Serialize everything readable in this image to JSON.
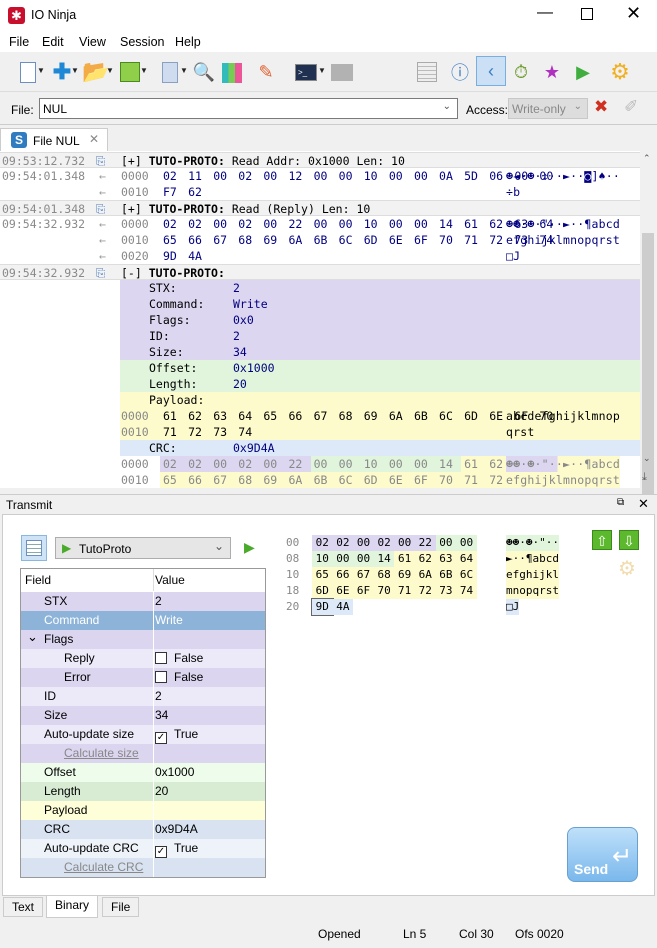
{
  "window": {
    "title": "IO Ninja",
    "minimize_icon": "minimize-icon",
    "maximize_icon": "maximize-icon",
    "close_icon": "close-icon"
  },
  "menu": [
    "File",
    "Edit",
    "View",
    "Session",
    "Help"
  ],
  "toolbar": {
    "icons": [
      "new-session-icon",
      "add-icon",
      "open-icon",
      "save-icon",
      "hex-view-icon",
      "find-icon",
      "highlighter-icon",
      "clear-log-icon",
      "terminal-icon",
      "terminal-disabled-icon",
      "log-filter-icon",
      "info-icon",
      "packet-icon",
      "timer-icon",
      "star-icon",
      "play-script-icon",
      "settings-icon"
    ]
  },
  "filebar": {
    "file_label": "File:",
    "file_value": "NUL",
    "access_label": "Access:",
    "access_value": "Write-only"
  },
  "session_tab": {
    "label": "File NUL"
  },
  "colors": {
    "purple": "#dcd6f0",
    "green": "#e0f5dc",
    "yellow": "#fdfbcc",
    "blue": "#dde8f8",
    "header": "#f2f2f2",
    "selected": "#8db4d8",
    "accent": "#5aa02c"
  },
  "log": [
    {
      "kind": "header",
      "time": "09:53:12.732",
      "expand": "[+]",
      "proto": "TUTO-PROTO:",
      "text": " Read Addr: 0x1000 Len: 10"
    },
    {
      "kind": "hex",
      "time": "09:54:01.348",
      "arrow": "←",
      "off": "0000",
      "hex": "02 11 00 02 00 12 00 00 10 00 00 0A 5D 06 00 00",
      "ascii": "☻◄·☻·↕··►··◙]♠··"
    },
    {
      "kind": "hex",
      "arrow": "←",
      "off": "0010",
      "hex": "F7 62",
      "ascii": "÷b"
    },
    {
      "kind": "header",
      "time": "09:54:01.348",
      "expand": "[+]",
      "proto": "TUTO-PROTO:",
      "text": " Read (Reply) Len: 10"
    },
    {
      "kind": "hex",
      "time": "09:54:32.932",
      "arrow": "←",
      "off": "0000",
      "hex": "02 02 00 02 00 22 00 00 10 00 00 14 61 62 63 64",
      "ascii": "☻☻·☻·\"··►··¶abcd"
    },
    {
      "kind": "hex",
      "arrow": "←",
      "off": "0010",
      "hex": "65 66 67 68 69 6A 6B 6C 6D 6E 6F 70 71 72 73 74",
      "ascii": "efghijklmnopqrst"
    },
    {
      "kind": "hex",
      "arrow": "←",
      "off": "0020",
      "hex": "9D 4A",
      "ascii": "□J"
    },
    {
      "kind": "header",
      "time": "09:54:32.932",
      "expand": "[-]",
      "proto": "TUTO-PROTO:",
      "text": ""
    },
    {
      "kind": "field",
      "bg": "purple",
      "label": "STX:",
      "value": "2"
    },
    {
      "kind": "field",
      "bg": "purple",
      "label": "Command:",
      "value": "Write"
    },
    {
      "kind": "field",
      "bg": "purple",
      "label": "Flags:",
      "value": "0x0"
    },
    {
      "kind": "field",
      "bg": "purple",
      "label": "ID:",
      "value": "2"
    },
    {
      "kind": "field",
      "bg": "purple",
      "label": "Size:",
      "value": "34"
    },
    {
      "kind": "field",
      "bg": "green",
      "label": "Offset:",
      "value": "0x1000"
    },
    {
      "kind": "field",
      "bg": "green",
      "label": "Length:",
      "value": "20"
    },
    {
      "kind": "field",
      "bg": "yellow",
      "label": "Payload:",
      "value": ""
    },
    {
      "kind": "hex",
      "bg": "yellow",
      "dark": true,
      "off": "0000",
      "hex": "61 62 63 64 65 66 67 68 69 6A 6B 6C 6D 6E 6F 70",
      "ascii": "abcdefghijklmnop"
    },
    {
      "kind": "hex",
      "bg": "yellow",
      "dark": true,
      "off": "0010",
      "hex": "71 72 73 74",
      "ascii": "qrst"
    },
    {
      "kind": "field",
      "bg": "blue",
      "label": "CRC:",
      "value": "0x9D4A"
    },
    {
      "kind": "hex",
      "seg": [
        "purple",
        "purple",
        "purple",
        "purple",
        "purple",
        "purple",
        "green",
        "green",
        "green",
        "green",
        "green",
        "green",
        "yellow",
        "yellow",
        "yellow",
        "yellow"
      ],
      "off": "0000",
      "hex": "02 02 00 02 00 22 00 00 10 00 00 14 61 62 63 64",
      "ascii": "☻☻·☻·\"··►··¶abcd"
    },
    {
      "kind": "hex",
      "seg": [
        "yellow",
        "yellow",
        "yellow",
        "yellow",
        "yellow",
        "yellow",
        "yellow",
        "yellow",
        "yellow",
        "yellow",
        "yellow",
        "yellow",
        "yellow",
        "yellow",
        "yellow",
        "yellow"
      ],
      "off": "0010",
      "hex": "65 66 67 68 69 6A 6B 6C 6D 6E 6F 70 71 72 73 74",
      "ascii": "efghijklmnopqrst"
    }
  ],
  "transmit": {
    "title": "Transmit",
    "protocol": "TutoProto",
    "grid_headers": {
      "field": "Field",
      "value": "Value"
    },
    "grid": [
      {
        "field": "STX",
        "value": "2",
        "bg": "#dcd5ef",
        "indent": 0
      },
      {
        "field": "Command",
        "value": "Write",
        "bg": "#8db4d8",
        "indent": 0,
        "selected": true
      },
      {
        "field": "Flags",
        "value": "",
        "bg": "#dcd5ef",
        "indent": 0,
        "expander": "⌄"
      },
      {
        "field": "Reply",
        "value": "False",
        "bg": "#ece9f8",
        "indent": 1,
        "checkbox": false
      },
      {
        "field": "Error",
        "value": "False",
        "bg": "#dcd5ef",
        "indent": 1,
        "checkbox": false
      },
      {
        "field": "ID",
        "value": "2",
        "bg": "#ece9f8",
        "indent": 0
      },
      {
        "field": "Size",
        "value": "34",
        "bg": "#dcd5ef",
        "indent": 0
      },
      {
        "field": "Auto-update size",
        "value": "True",
        "bg": "#ece9f8",
        "indent": 0,
        "checkbox": true
      },
      {
        "field": "Calculate size",
        "value": "",
        "bg": "#dcd5ef",
        "indent": 1,
        "link": true
      },
      {
        "field": "Offset",
        "value": "0x1000",
        "bg": "#eefceb",
        "indent": 0
      },
      {
        "field": "Length",
        "value": "20",
        "bg": "#d8ecd4",
        "indent": 0
      },
      {
        "field": "Payload",
        "value": "",
        "bg": "#fefed8",
        "indent": 0
      },
      {
        "field": "CRC",
        "value": "0x9D4A",
        "bg": "#d8e2f0",
        "indent": 0
      },
      {
        "field": "Auto-update CRC",
        "value": "True",
        "bg": "#eef3fa",
        "indent": 0,
        "checkbox": true
      },
      {
        "field": "Calculate CRC",
        "value": "",
        "bg": "#d8e2f0",
        "indent": 1,
        "link": true
      }
    ],
    "hex": [
      {
        "off": "00",
        "bytes": [
          "02",
          "02",
          "00",
          "02",
          "00",
          "22",
          "00",
          "00"
        ],
        "seg": [
          "purple",
          "purple",
          "purple",
          "purple",
          "purple",
          "purple",
          "green",
          "green"
        ],
        "ascii": "☻☻·☻·\"··"
      },
      {
        "off": "08",
        "bytes": [
          "10",
          "00",
          "00",
          "14",
          "61",
          "62",
          "63",
          "64"
        ],
        "seg": [
          "green",
          "green",
          "green",
          "green",
          "yellow",
          "yellow",
          "yellow",
          "yellow"
        ],
        "ascii": "►··¶abcd"
      },
      {
        "off": "10",
        "bytes": [
          "65",
          "66",
          "67",
          "68",
          "69",
          "6A",
          "6B",
          "6C"
        ],
        "seg": [
          "yellow",
          "yellow",
          "yellow",
          "yellow",
          "yellow",
          "yellow",
          "yellow",
          "yellow"
        ],
        "ascii": "efghijkl"
      },
      {
        "off": "18",
        "bytes": [
          "6D",
          "6E",
          "6F",
          "70",
          "71",
          "72",
          "73",
          "74"
        ],
        "seg": [
          "yellow",
          "yellow",
          "yellow",
          "yellow",
          "yellow",
          "yellow",
          "yellow",
          "yellow"
        ],
        "ascii": "mnopqrst"
      },
      {
        "off": "20",
        "bytes": [
          "9D",
          "4A"
        ],
        "seg": [
          "blue",
          "blue"
        ],
        "ascii": "□J"
      }
    ],
    "send_label": "Send",
    "bottom_tabs": [
      "Text",
      "Binary",
      "File"
    ],
    "active_tab": "Binary"
  },
  "status": {
    "state": "Opened",
    "line": "Ln 5",
    "col": "Col 30",
    "offset": "Ofs 0020"
  }
}
